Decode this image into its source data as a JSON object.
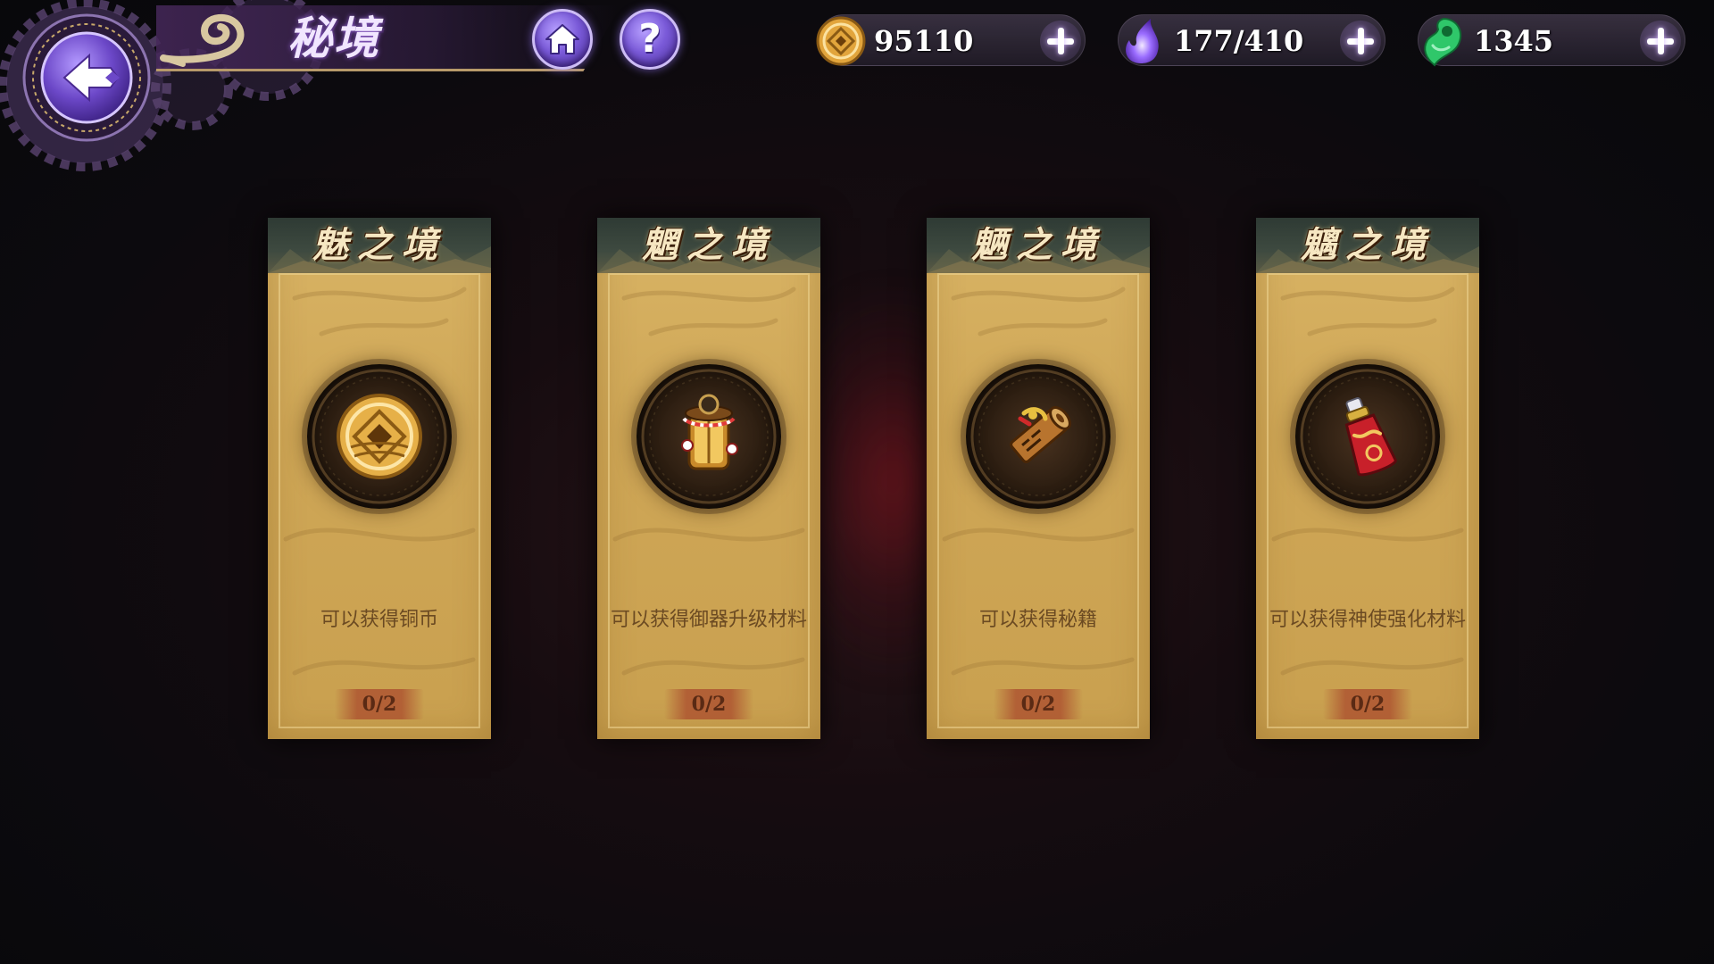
{
  "header": {
    "title": "秘境",
    "back_button_icon": "back-arrow-icon",
    "home_button_icon": "home-icon",
    "help_button_icon": "help-icon",
    "help_glyph": "?"
  },
  "resources": [
    {
      "name": "copper_coins",
      "icon": "copper-coin-icon",
      "value": "95110"
    },
    {
      "name": "stamina",
      "icon": "spirit-flame-icon",
      "value": "177/410"
    },
    {
      "name": "jade",
      "icon": "jade-magatama-icon",
      "value": "1345"
    }
  ],
  "cards": [
    {
      "title": "魅之境",
      "icon": "copper-coin-icon",
      "description": "可以获得铜币",
      "progress": "0/2"
    },
    {
      "title": "魍之境",
      "icon": "lantern-material-icon",
      "description": "可以获得御器升级材料",
      "progress": "0/2"
    },
    {
      "title": "魉之境",
      "icon": "scroll-icon",
      "description": "可以获得秘籍",
      "progress": "0/2"
    },
    {
      "title": "魑之境",
      "icon": "elixir-bottle-icon",
      "description": "可以获得神使强化材料",
      "progress": "0/2"
    }
  ],
  "colors": {
    "card_gold": "#cfa757",
    "header_purple": "#46285a",
    "accent_violet": "#7a5ad8",
    "card_text": "#6b4a22"
  }
}
